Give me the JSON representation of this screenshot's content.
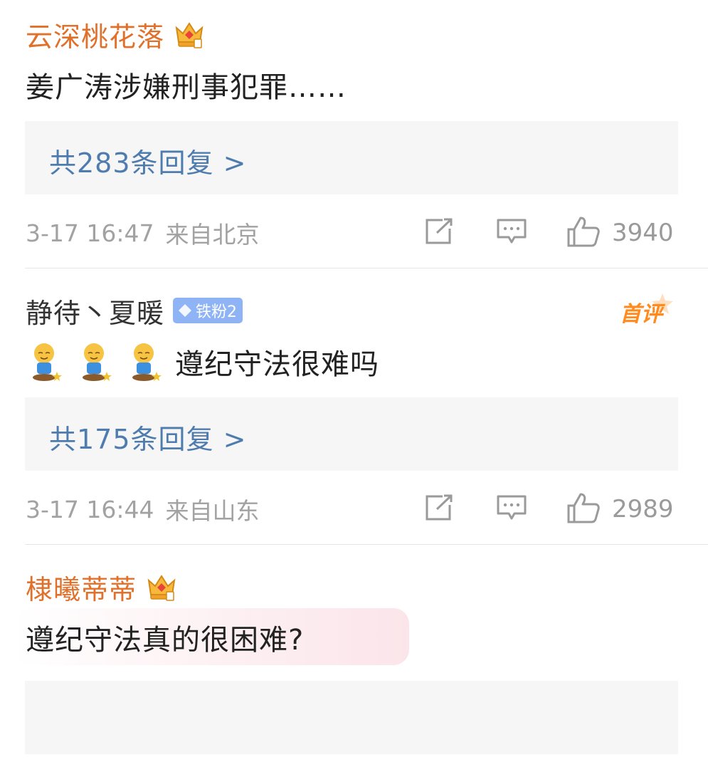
{
  "comments": [
    {
      "user": "云深桃花落",
      "text": "姜广涛涉嫌刑事犯罪……",
      "replies_label": "共283条回复 >",
      "time": "3-17 16:47",
      "location": "来自北京",
      "likes": "3940",
      "name_color": "#e0702a",
      "badge_icon": "vip-crown-icon"
    },
    {
      "user": "静待丶夏暖",
      "badge_label": "铁粉2",
      "first_tag": "首评",
      "text": "遵纪守法很难吗",
      "emoji_icon": "kneeling-smile-emoji",
      "replies_label": "共175条回复 >",
      "time": "3-17 16:44",
      "location": "来自山东",
      "likes": "2989"
    },
    {
      "user": "棣曦蒂蒂",
      "text": "遵纪守法真的很困难?",
      "name_color": "#e0702a",
      "badge_icon": "vip-crown-icon"
    }
  ],
  "colors": {
    "accent_name": "#e0702a",
    "reply_link": "#4f7cae",
    "meta_gray": "#a2a2a2",
    "reply_bg": "#f6f6f6",
    "fan_badge": "#8fb4f6",
    "first_tag": "#ff8a1e"
  },
  "icons": {
    "share": "share-icon",
    "comment": "comment-icon",
    "like": "thumbs-up-icon"
  }
}
